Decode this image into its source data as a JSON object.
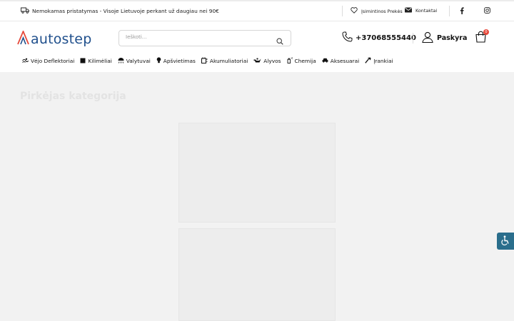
{
  "topbar": {
    "shipping_text": "Nemokamas pristatymas - Visoje Lietuvoje perkant už daugiau nei 90€",
    "saved_items_label": "Įsimintinos Prekės",
    "contacts_label": "Kontaktai"
  },
  "header": {
    "logo_text": "autostep",
    "search_placeholder": "Ieškoti...",
    "phone": "+37068555440",
    "account_label": "Paskyra",
    "cart_count": "0"
  },
  "nav": {
    "items": [
      {
        "label": "Vėjo Deflektoriai",
        "icon": "fan-icon"
      },
      {
        "label": "Kilimėliai",
        "icon": "mat-icon"
      },
      {
        "label": "Valytuvai",
        "icon": "wiper-icon"
      },
      {
        "label": "Apšvietimas",
        "icon": "bulb-icon"
      },
      {
        "label": "Akumuliatoriai",
        "icon": "battery-icon"
      },
      {
        "label": "Alyvos",
        "icon": "oil-can-icon"
      },
      {
        "label": "Chemija",
        "icon": "spray-icon"
      },
      {
        "label": "Aksesuarai",
        "icon": "car-icon"
      },
      {
        "label": "Įrankiai",
        "icon": "hammer-icon"
      }
    ]
  },
  "main": {
    "title": "Pirkėjas kategorija"
  },
  "colors": {
    "brand_blue": "#1f4f8c",
    "brand_red": "#e64a3c",
    "accessibility": "#2a6e8c"
  }
}
